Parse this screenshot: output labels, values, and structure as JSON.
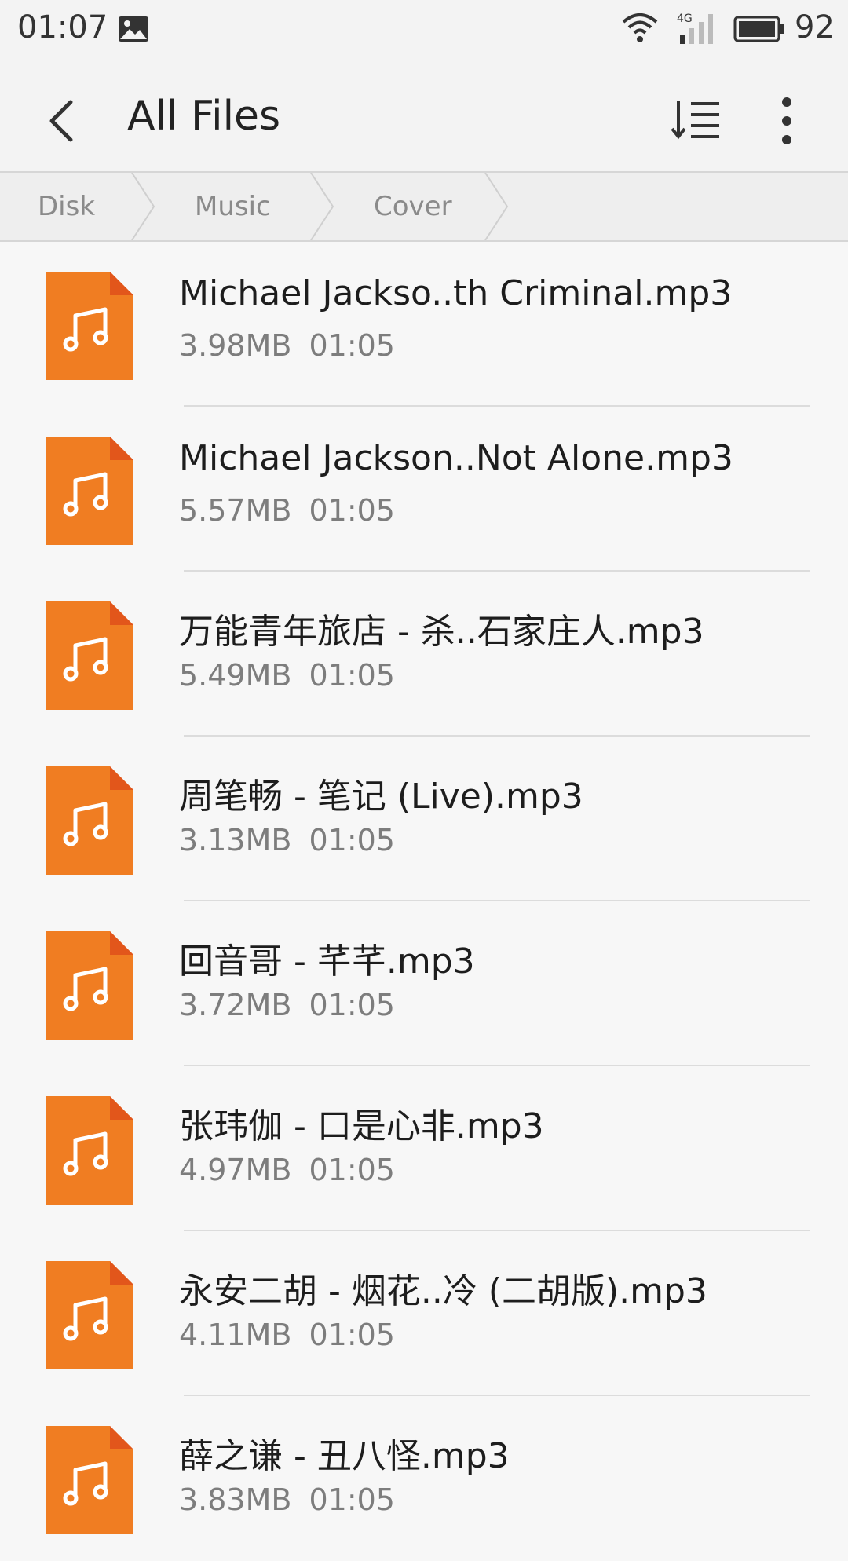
{
  "status_bar": {
    "time": "01:07",
    "network": "4G",
    "battery": "92"
  },
  "app_bar": {
    "title": "All Files"
  },
  "breadcrumb": [
    "Disk",
    "Music",
    "Cover"
  ],
  "files": [
    {
      "name": "Michael Jackso..th Criminal.mp3",
      "size": "3.98MB",
      "time": "01:05"
    },
    {
      "name": "Michael Jackson..Not Alone.mp3",
      "size": "5.57MB",
      "time": "01:05"
    },
    {
      "name": "万能青年旅店 - 杀..石家庄人.mp3",
      "size": "5.49MB",
      "time": "01:05"
    },
    {
      "name": "周笔畅 - 笔记 (Live).mp3",
      "size": "3.13MB",
      "time": "01:05"
    },
    {
      "name": "回音哥 - 芊芊.mp3",
      "size": "3.72MB",
      "time": "01:05"
    },
    {
      "name": "张玮伽 - 口是心非.mp3",
      "size": "4.97MB",
      "time": "01:05"
    },
    {
      "name": "永安二胡 - 烟花..冷 (二胡版).mp3",
      "size": "4.11MB",
      "time": "01:05"
    },
    {
      "name": "薛之谦 - 丑八怪.mp3",
      "size": "3.83MB",
      "time": "01:05"
    }
  ],
  "colors": {
    "file_icon": "#f07d22",
    "file_icon_fold": "#e2561b"
  },
  "icons": {
    "back": "back-arrow-icon",
    "sort": "sort-icon",
    "more": "more-vertical-icon",
    "file": "music-file-icon"
  }
}
